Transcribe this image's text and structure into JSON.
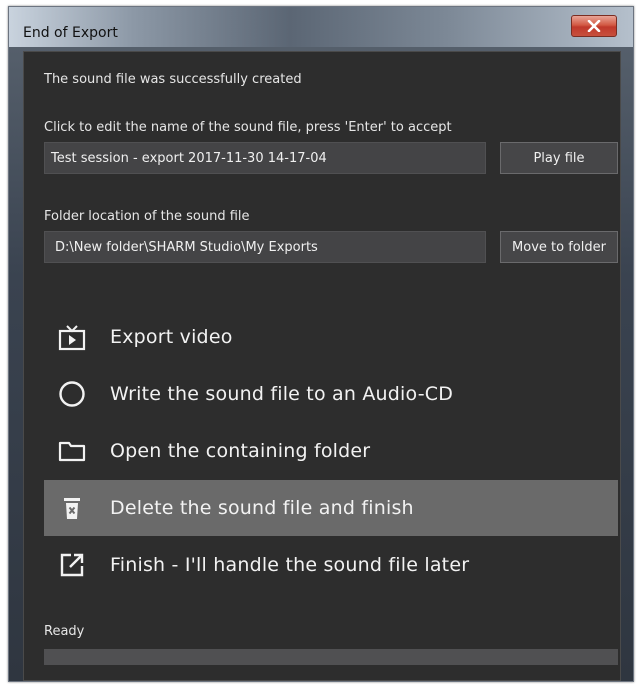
{
  "window": {
    "title": "End of Export"
  },
  "message": {
    "success": "The sound file was successfully created"
  },
  "filename": {
    "label": "Click to edit the name of the sound file, press 'Enter' to accept",
    "value": "Test session - export 2017-11-30 14-17-04",
    "play_label": "Play file"
  },
  "folder": {
    "label": "Folder location of the sound file",
    "value": "D:\\New folder\\SHARM Studio\\My Exports",
    "move_label": "Move to folder"
  },
  "actions": [
    {
      "label": "Export video",
      "icon": "tv-play-icon"
    },
    {
      "label": "Write the sound file to an Audio-CD",
      "icon": "circle-icon"
    },
    {
      "label": "Open the containing folder",
      "icon": "folder-icon"
    },
    {
      "label": "Delete the sound file and finish",
      "icon": "trash-icon",
      "selected": true
    },
    {
      "label": "Finish - I'll handle the sound file later",
      "icon": "open-external-icon"
    }
  ],
  "status": {
    "text": "Ready",
    "progress": 0
  },
  "colors": {
    "selected_row": "#6a6a6a",
    "panel_bg": "#2d2d2d",
    "close_button": "#c0392b"
  }
}
